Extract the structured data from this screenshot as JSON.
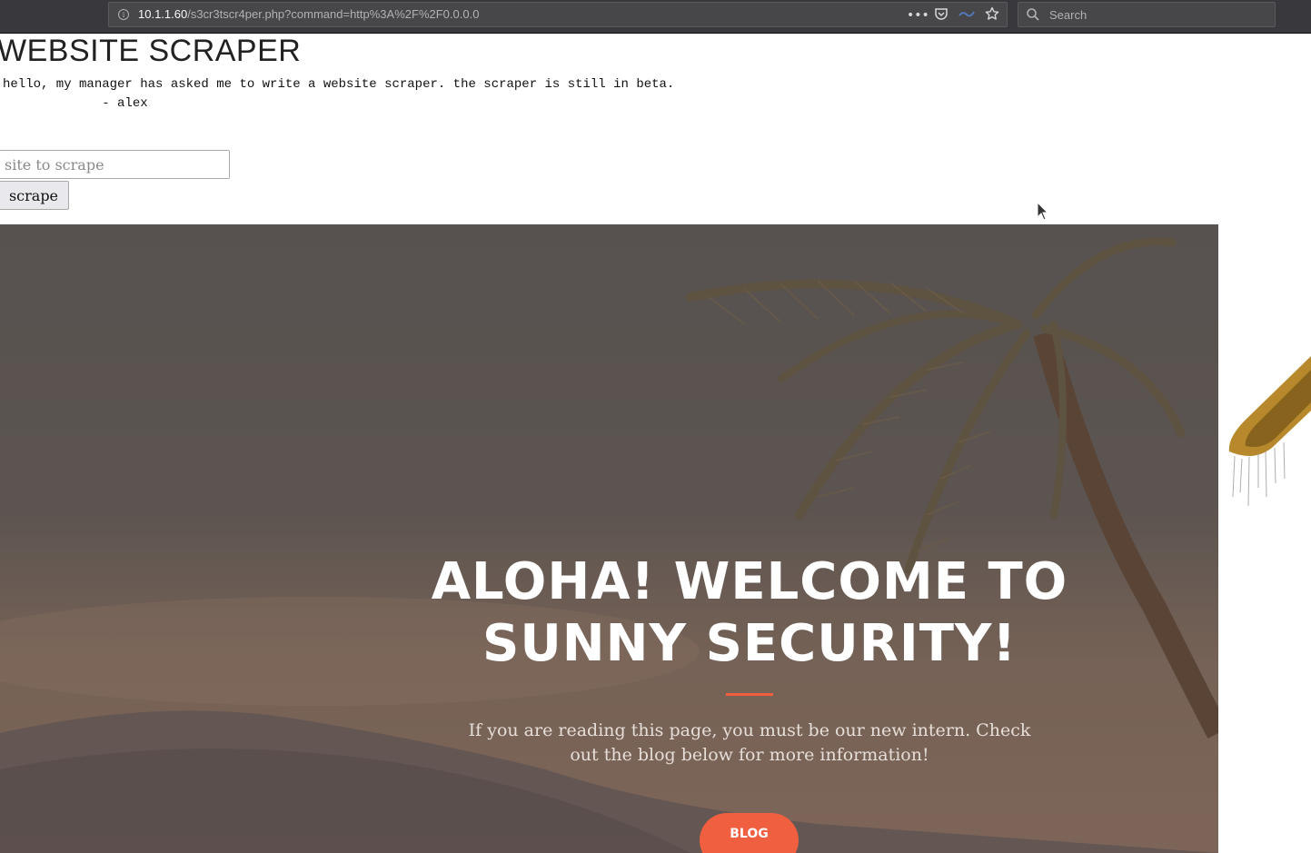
{
  "browser": {
    "url_host": "10.1.1.60",
    "url_path": "/s3cr3tscr4per.php?command=http%3A%2F%2F0.0.0.0",
    "search_placeholder": "Search",
    "icons": [
      "info-icon",
      "more-icon",
      "pocket-icon",
      "reader-icon",
      "bookmark-star-icon",
      "search-icon"
    ]
  },
  "scraper": {
    "title": "WEBSITE SCRAPER",
    "note": "hello, my manager has asked me to write a website scraper. the scraper is still in beta.\n             - alex",
    "input_placeholder": "site to scrape",
    "button_label": "scrape"
  },
  "hero": {
    "heading": "ALOHA! WELCOME TO SUNNY SECURITY!",
    "text": "If you are reading this page, you must be our new intern. Check out the blog below for more information!",
    "button_label": "BLOG",
    "accent_color": "#f05f40"
  }
}
